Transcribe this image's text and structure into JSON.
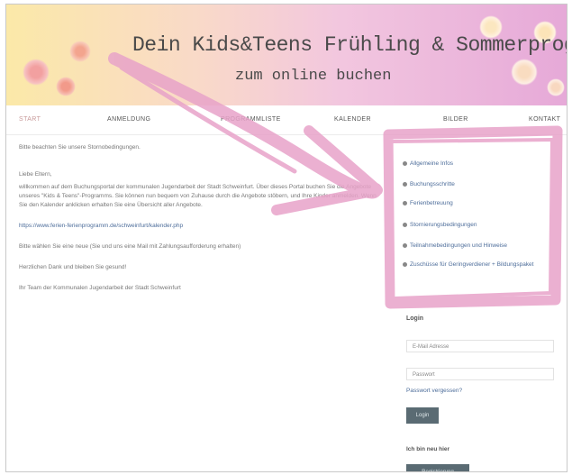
{
  "header": {
    "title_line1": "Dein Kids&Teens Frühling & Sommerprogramm",
    "title_line2": "zum online buchen"
  },
  "nav": {
    "items": [
      "START",
      "ANMELDUNG",
      "PROGRAMMLISTE",
      "KALENDER",
      "BILDER",
      "KONTAKT"
    ]
  },
  "main": {
    "notice": "Bitte beachten Sie unsere Stornobedingungen.",
    "greeting": "Liebe Eltern,",
    "intro": "willkommen auf dem Buchungsportal der kommunalen Jugendarbeit der Stadt Schweinfurt. Über dieses Portal buchen Sie die Angebote unseres \"Kids & Teens\"-Programms. Sie können nun bequem von Zuhause durch die Angebote stöbern, und Ihre Kinder anmelden. Wenn Sie den Kalender anklicken erhalten Sie eine Übersicht aller Angebote.",
    "link": "https://www.ferien-ferienprogramm.de/schweinfurt/kalender.php",
    "note": "Bitte wählen Sie eine neue (Sie und uns eine Mail mit Zahlungsaufforderung erhalten)",
    "thanks": "Herzlichen Dank und bleiben Sie gesund!",
    "signature": "Ihr Team der Kommunalen Jugendarbeit der Stadt Schweinfurt"
  },
  "sidebar": {
    "items": [
      "Allgemeine Infos",
      "Buchungsschritte",
      "Ferienbetreuung",
      "Stornierungsbedingungen",
      "Teilnahmebedingungen und Hinweise",
      "Zuschüsse für Geringverdiener + Bildungspaket"
    ]
  },
  "login": {
    "title": "Login",
    "email_placeholder": "E-Mail Adresse",
    "password_placeholder": "Passwort",
    "forgot_link": "Passwort vergessen?",
    "login_button": "Login",
    "new_title": "Ich bin neu hier",
    "register_button": "Registrierung"
  },
  "colors": {
    "annotation": "#e8a3c9",
    "link": "#4d6d9a",
    "button": "#5a6b73"
  }
}
